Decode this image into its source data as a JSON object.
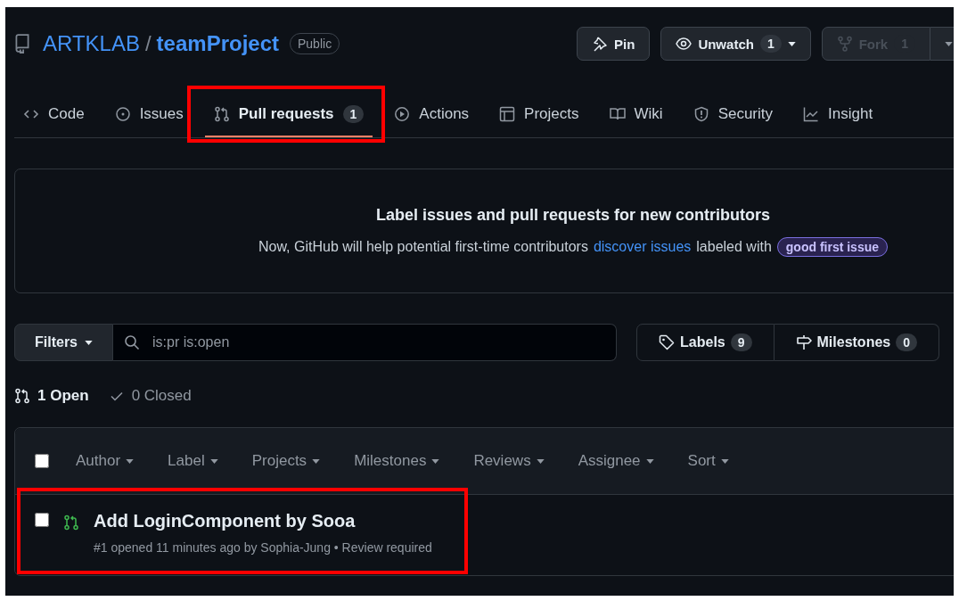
{
  "repo": {
    "owner": "ARTKLAB",
    "separator": "/",
    "name": "teamProject",
    "visibility": "Public"
  },
  "actions": [
    {
      "kind": "pin",
      "label": "Pin",
      "disabled": false
    },
    {
      "kind": "watch",
      "label": "Unwatch",
      "count": "1",
      "disabled": false
    },
    {
      "kind": "fork",
      "label": "Fork",
      "count": "1",
      "disabled": true
    }
  ],
  "tabs": [
    {
      "kind": "code",
      "label": "Code",
      "selected": false,
      "highlighted": false
    },
    {
      "kind": "issues",
      "label": "Issues",
      "selected": false,
      "highlighted": false
    },
    {
      "kind": "pulls",
      "label": "Pull requests",
      "count": "1",
      "selected": true,
      "highlighted": true
    },
    {
      "kind": "actions",
      "label": "Actions",
      "selected": false,
      "highlighted": false
    },
    {
      "kind": "projects",
      "label": "Projects",
      "selected": false,
      "highlighted": false
    },
    {
      "kind": "wiki",
      "label": "Wiki",
      "selected": false,
      "highlighted": false
    },
    {
      "kind": "security",
      "label": "Security",
      "selected": false,
      "highlighted": false
    },
    {
      "kind": "insights",
      "label": "Insight",
      "selected": false,
      "highlighted": false
    }
  ],
  "banner": {
    "title": "Label issues and pull requests for new contributors",
    "text": "Now, GitHub will help potential first-time contributors",
    "link": "discover issues",
    "text_after": "labeled with",
    "label": "good first issue"
  },
  "filter_bar": {
    "button": "Filters",
    "search_value": "is:pr is:open"
  },
  "label_buttons": [
    {
      "kind": "labels",
      "label": "Labels",
      "count": "9"
    },
    {
      "kind": "milestones",
      "label": "Milestones",
      "count": "0"
    }
  ],
  "states": [
    {
      "kind": "open",
      "label": "1 Open",
      "selected": true
    },
    {
      "kind": "closed",
      "label": "0 Closed",
      "selected": false
    }
  ],
  "list": {
    "select_all_checked": false,
    "filters": [
      "Author",
      "Label",
      "Projects",
      "Milestones",
      "Reviews",
      "Assignee",
      "Sort"
    ],
    "rows": [
      {
        "title": "Add LoginComponent by Sooa",
        "meta": "#1 opened 11 minutes ago by Sophia-Jung • Review required",
        "checked": false,
        "highlighted": true
      }
    ]
  }
}
